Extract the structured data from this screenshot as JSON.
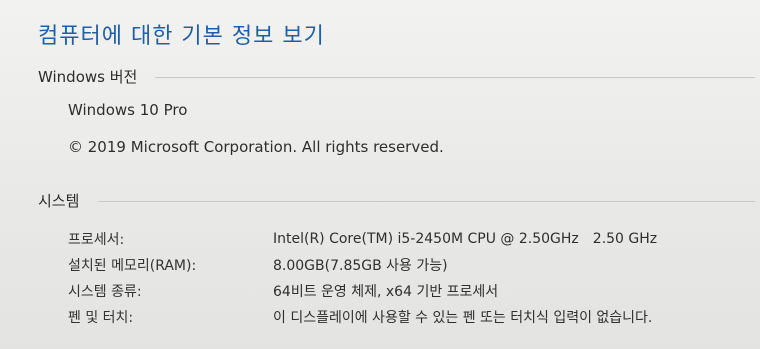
{
  "page_title": "컴퓨터에 대한 기본 정보 보기",
  "windows_edition": {
    "heading": "Windows 버전",
    "edition": "Windows 10 Pro",
    "copyright": "© 2019 Microsoft Corporation. All rights reserved."
  },
  "system": {
    "heading": "시스템",
    "rows": [
      {
        "label": "프로세서:",
        "value": "Intel(R) Core(TM) i5-2450M CPU @ 2.50GHz",
        "extra": "2.50 GHz"
      },
      {
        "label": "설치된 메모리(RAM):",
        "value": "8.00GB(7.85GB 사용 가능)"
      },
      {
        "label": "시스템 종류:",
        "value": "64비트 운영 체제, x64 기반 프로세서"
      },
      {
        "label": "펜 및 터치:",
        "value": "이 디스플레이에 사용할 수 있는 펜 또는 터치식 입력이 없습니다."
      }
    ]
  },
  "colors": {
    "title_blue": "#1f5fa8",
    "background": "#ececea"
  }
}
